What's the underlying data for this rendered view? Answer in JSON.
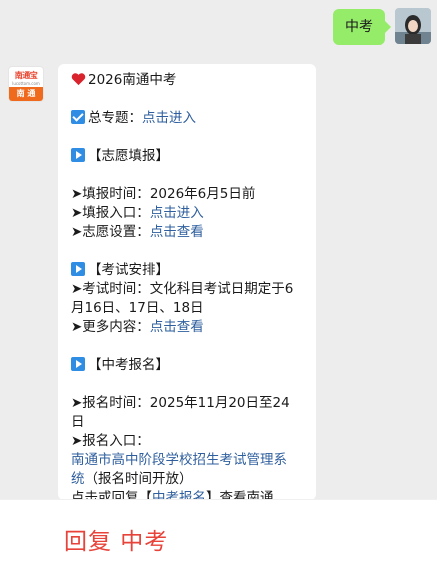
{
  "user_message": {
    "text": "中考"
  },
  "bot": {
    "avatar_top": "南通宝",
    "avatar_url": "lucottom.com",
    "avatar_bottom": "南 通"
  },
  "message": {
    "title": "2026南通中考",
    "topic_label": "总专题：",
    "topic_link": "点击进入",
    "section1": {
      "heading": "【志愿填报】",
      "time_label": "➤填报时间：",
      "time_value": "2026年6月5日前",
      "entry_label": "➤填报入口：",
      "entry_link": "点击进入",
      "settings_label": "➤志愿设置：",
      "settings_link": "点击查看"
    },
    "section2": {
      "heading": "【考试安排】",
      "exam_line1": "➤考试时间：文化科目考试日期定于6",
      "exam_line2": "月16日、17日、18日",
      "more_label": "➤更多内容：",
      "more_link": "点击查看"
    },
    "section3": {
      "heading": "【中考报名】",
      "time_line1": "➤报名时间：2025年11月20日至24",
      "time_line2": "日",
      "entry_label": "➤报名入口：",
      "system_link_line1": "南通市高中阶段学校招生考试管理系",
      "system_link_line2": "统",
      "system_note": "（报名时间开放）",
      "reply_prefix": "点击或回复【",
      "reply_link": "中考报名",
      "reply_suffix": "】查看南通"
    }
  },
  "bottom_bar": {
    "text": "回复 中考"
  }
}
